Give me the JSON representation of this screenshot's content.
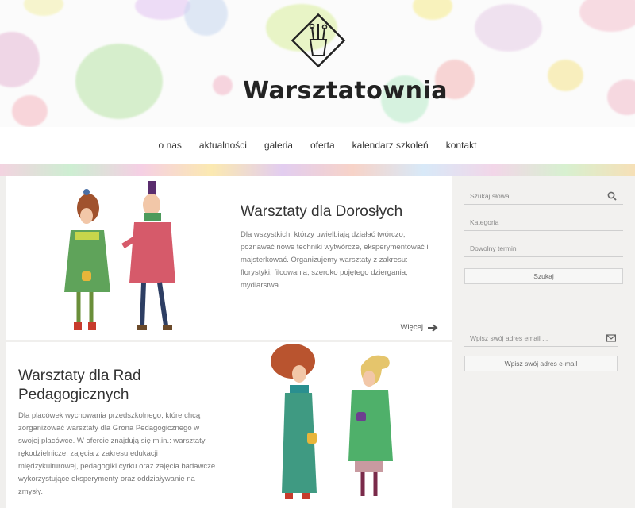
{
  "site": {
    "name": "Warsztatownia"
  },
  "nav": [
    "o nas",
    "aktualności",
    "galeria",
    "oferta",
    "kalendarz szkoleń",
    "kontakt"
  ],
  "cards": [
    {
      "title": "Warsztaty dla Dorosłych",
      "text": "Dla wszystkich, którzy uwielbiają działać twórczo, poznawać nowe techniki wytwórcze, eksperymentować i majsterkować. Organizujemy warsztaty z zakresu: florystyki, filcowania, szeroko pojętego dziergania, mydlarstwa.",
      "more": "Więcej"
    },
    {
      "title": "Warsztaty dla Rad Pedagogicznych",
      "text": "Dla placówek wychowania przedszkolnego, które chcą zorganizować warsztaty dla Grona Pedagogicznego w swojej placówce. W ofercie znajdują się m.in.: warsztaty rękodzielnicze, zajęcia z zakresu edukacji międzykulturowej, pedagogiki cyrku oraz zajęcia badawcze wykorzystujące eksperymenty oraz oddziaływanie na zmysły."
    }
  ],
  "sidebar": {
    "search_placeholder": "Szukaj słowa...",
    "category_placeholder": "Kategoria",
    "date_placeholder": "Dowolny termin",
    "search_button": "Szukaj",
    "email_placeholder": "Wpisz swój adres email ...",
    "email_button": "Wpisz swój adres e-mail"
  },
  "icons": {
    "search": "search-icon",
    "mail": "mail-icon",
    "arrow": "arrow-right-icon",
    "logo": "pencil-cup-logo"
  },
  "colors": {
    "accent": "#555555",
    "panel": "#f2f1ef"
  }
}
